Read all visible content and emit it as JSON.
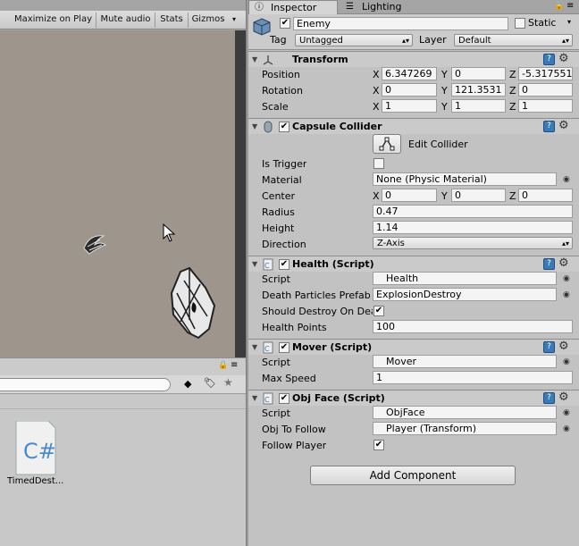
{
  "game_view": {
    "toolbar": [
      "Maximize on Play",
      "Mute audio",
      "Stats",
      "Gizmos"
    ]
  },
  "project": {
    "asset_name": "TimedDest..."
  },
  "inspector": {
    "tabs": {
      "inspector": "Inspector",
      "lighting": "Lighting"
    },
    "object_name": "Enemy",
    "static_label": "Static",
    "tag_label": "Tag",
    "tag_value": "Untagged",
    "layer_label": "Layer",
    "layer_value": "Default",
    "transform": {
      "title": "Transform",
      "position_label": "Position",
      "rotation_label": "Rotation",
      "scale_label": "Scale",
      "position": {
        "x": "6.347269",
        "y": "0",
        "z": "-5.317551"
      },
      "rotation": {
        "x": "0",
        "y": "121.3531",
        "z": "0"
      },
      "scale": {
        "x": "1",
        "y": "1",
        "z": "1"
      }
    },
    "capsule": {
      "title": "Capsule Collider",
      "edit_collider": "Edit Collider",
      "is_trigger_label": "Is Trigger",
      "material_label": "Material",
      "material_value": "None (Physic Material)",
      "center_label": "Center",
      "center": {
        "x": "0",
        "y": "0",
        "z": "0"
      },
      "radius_label": "Radius",
      "radius": "0.47",
      "height_label": "Height",
      "height": "1.14",
      "direction_label": "Direction",
      "direction": "Z-Axis"
    },
    "health": {
      "title": "Health (Script)",
      "script_label": "Script",
      "script": "Health",
      "death_label": "Death Particles Prefab",
      "death_value": "ExplosionDestroy",
      "should_destroy_label": "Should Destroy On Death",
      "hp_label": "Health Points",
      "hp": "100"
    },
    "mover": {
      "title": "Mover (Script)",
      "script_label": "Script",
      "script": "Mover",
      "max_speed_label": "Max Speed",
      "max_speed": "1"
    },
    "objface": {
      "title": "Obj Face (Script)",
      "script_label": "Script",
      "script": "ObjFace",
      "follow_label": "Obj To Follow",
      "follow_value": "Player (Transform)",
      "follow_player_label": "Follow Player"
    },
    "add_component": "Add Component"
  }
}
